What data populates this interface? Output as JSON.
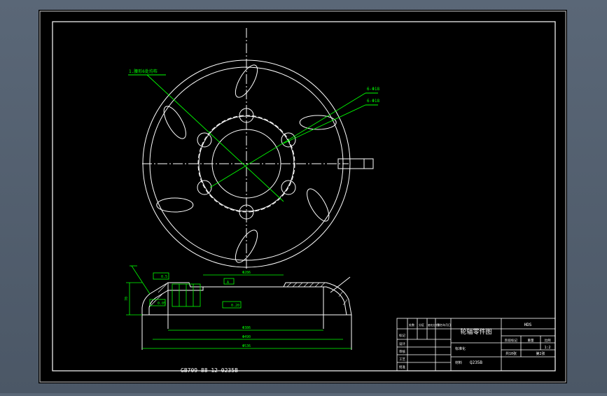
{
  "drawing": {
    "part_number": "GB709-88-12-0235B",
    "title_block": {
      "title": "轮辐零件图",
      "top_right": "HDS",
      "labels_row": [
        "阶段标记",
        "重量",
        "比例"
      ],
      "ratio": "1:2",
      "material": "Q235B",
      "scale_note": "共10张",
      "sheet_note": "第2张",
      "left_labels": [
        "标记",
        "设计",
        "审核",
        "工艺",
        "批准"
      ],
      "mid_labels": [
        "处数",
        "分区",
        "更改文件号",
        "签名",
        "年月日"
      ],
      "material_label": "材料",
      "stamp": "标准化"
    },
    "callouts": {
      "slot_leader": "1.腰形6处均布",
      "bolt_leader_a": "6-Φ18",
      "bolt_leader_b": "6-Φ18"
    },
    "section_dims": {
      "top_width": "Φ286",
      "inner_width": "Φ386",
      "mid_width": "Φ490",
      "outer_width": "Φ536",
      "height": "70",
      "tol_1": "0.5",
      "tol_2": "0.05",
      "tol_3": "0.20",
      "flag": "A"
    }
  },
  "colors": {
    "background": "#000000",
    "frame": "#ffffff",
    "geometry": "#ffffff",
    "dimension": "#00ff00",
    "window": "#56606f"
  }
}
